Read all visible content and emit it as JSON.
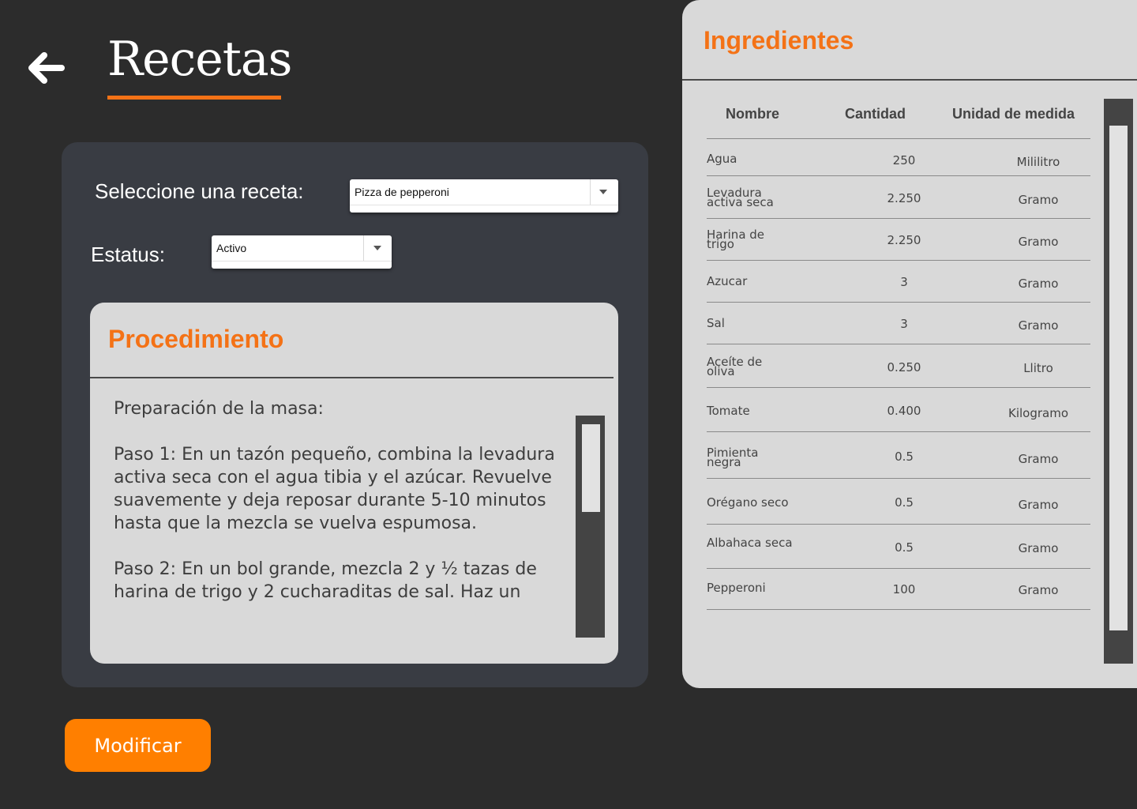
{
  "header": {
    "title": "Recetas",
    "back_icon": "arrow-left-icon"
  },
  "recipe_select": {
    "label": "Seleccione una receta:",
    "value": "Pizza de pepperoni"
  },
  "status_select": {
    "label": "Estatus:",
    "value": "Activo"
  },
  "procedure": {
    "title": "Procedimiento",
    "paragraphs": [
      "Preparación de la masa:",
      "Paso 1: En un tazón pequeño, combina la levadura activa seca con el agua tibia y el azúcar. Revuelve suavemente y deja reposar durante 5-10 minutos hasta que la mezcla se vuelva espumosa.",
      "Paso 2: En un bol grande, mezcla 2 y ½ tazas de harina de trigo y 2 cucharaditas de sal. Haz un"
    ]
  },
  "actions": {
    "modify_label": "Modificar"
  },
  "ingredients": {
    "title": "Ingredientes",
    "columns": [
      "Nombre",
      "Cantidad",
      "Unidad de medida"
    ],
    "rows": [
      {
        "name": "Agua",
        "qty": "250",
        "unit": "Mililitro"
      },
      {
        "name": "Levadura activa seca",
        "qty": "2.250",
        "unit": "Gramo"
      },
      {
        "name": "Harina de trigo",
        "qty": "2.250",
        "unit": "Gramo"
      },
      {
        "name": "Azucar",
        "qty": "3",
        "unit": "Gramo"
      },
      {
        "name": "Sal",
        "qty": "3",
        "unit": "Gramo"
      },
      {
        "name": "Aceíte de oliva",
        "qty": "0.250",
        "unit": "Llitro"
      },
      {
        "name": "Tomate",
        "qty": "0.400",
        "unit": "Kilogramo"
      },
      {
        "name": "Pimienta negra",
        "qty": "0.5",
        "unit": "Gramo"
      },
      {
        "name": "Orégano seco",
        "qty": "0.5",
        "unit": "Gramo"
      },
      {
        "name": "Albahaca seca",
        "qty": "0.5",
        "unit": "Gramo"
      },
      {
        "name": "Pepperoni",
        "qty": "100",
        "unit": "Gramo"
      }
    ]
  },
  "colors": {
    "accent": "#f47216",
    "button": "#ff7f00",
    "background": "#2c2c2c",
    "panel": "#393c43",
    "card": "#d9d9d9"
  }
}
